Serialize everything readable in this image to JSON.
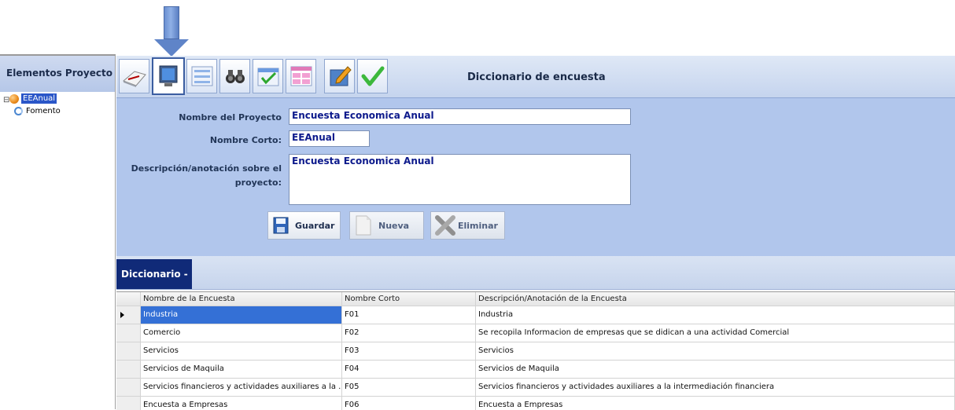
{
  "left_panel": {
    "title": "Elementos Proyecto",
    "tree": [
      {
        "label": "EEAnual",
        "icon": "orange-circle-icon",
        "selected": true
      },
      {
        "label": "Fomento",
        "icon": "cycle-icon",
        "selected": false
      }
    ]
  },
  "toolbar": {
    "title": "Diccionario de encuesta",
    "buttons": [
      {
        "name": "book-icon"
      },
      {
        "name": "monitor-icon",
        "active": true
      },
      {
        "name": "form-icon"
      },
      {
        "name": "binoculars-icon"
      },
      {
        "name": "checklist-icon"
      },
      {
        "name": "table-icon"
      },
      {
        "name": "edit-icon"
      },
      {
        "name": "checkmark-icon"
      }
    ]
  },
  "form": {
    "project_name_label": "Nombre del Proyecto",
    "project_name_value": "Encuesta Economica Anual",
    "short_name_label": "Nombre Corto:",
    "short_name_value": "EEAnual",
    "description_label_line1": "Descripción/anotación sobre el",
    "description_label_line2": "proyecto:",
    "description_value": "Encuesta Economica Anual",
    "save_label": "Guardar",
    "new_label": "Nueva",
    "delete_label": "Eliminar"
  },
  "dictionary": {
    "tab_label": "Diccionario -",
    "columns": [
      "Nombre de la Encuesta",
      "Nombre Corto",
      "Descripción/Anotación de la Encuesta"
    ],
    "rows": [
      [
        "Industria",
        "F01",
        "Industria"
      ],
      [
        "Comercio",
        "F02",
        "Se recopila Informacion de empresas que se didican a una actividad Comercial"
      ],
      [
        "Servicios",
        "F03",
        "Servicios"
      ],
      [
        "Servicios de Maquila",
        "F04",
        "Servicios de Maquila"
      ],
      [
        "Servicios financieros y actividades auxiliares a la ...",
        "F05",
        "Servicios financieros y actividades auxiliares a la intermediación financiera"
      ],
      [
        "Encuesta a Empresas",
        "F06",
        "Encuesta a Empresas"
      ]
    ],
    "selected_row": 0
  },
  "colors": {
    "form_bg": "#b1c6ec",
    "dict_tab_bg": "#102a78",
    "selection": "#3470d6",
    "input_text": "#0d1a8c"
  }
}
